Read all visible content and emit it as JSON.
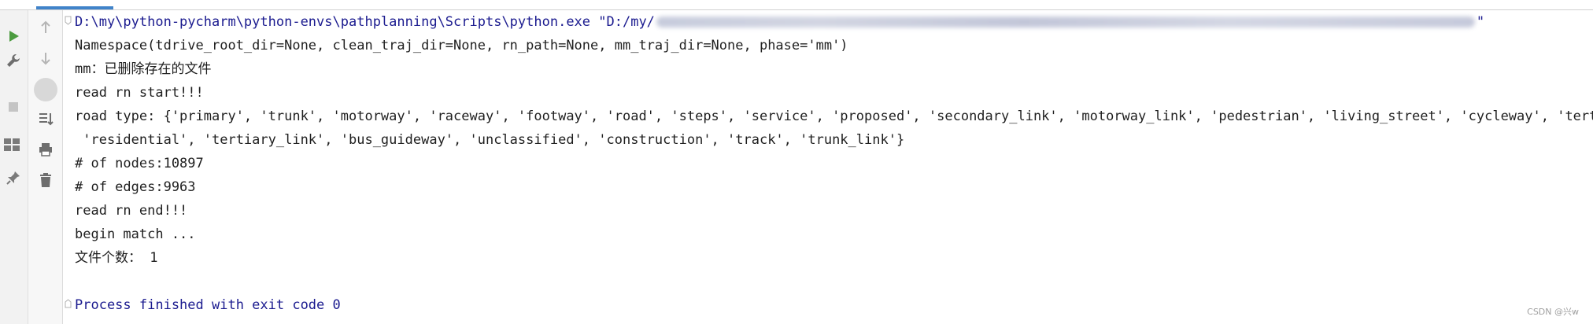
{
  "console": {
    "command": {
      "prefix": "D:\\my\\python-pycharm\\python-envs\\pathplanning\\Scripts\\python.exe \"D:/my/",
      "suffix": "\""
    },
    "output": [
      "Namespace(tdrive_root_dir=None, clean_traj_dir=None, rn_path=None, mm_traj_dir=None, phase='mm')",
      "mm：已删除存在的文件",
      "read rn start!!!",
      "road type: {'primary', 'trunk', 'motorway', 'raceway', 'footway', 'road', 'steps', 'service', 'proposed', 'secondary_link', 'motorway_link', 'pedestrian', 'living_street', 'cycleway', 'tertiary",
      " 'residential', 'tertiary_link', 'bus_guideway', 'unclassified', 'construction', 'track', 'trunk_link'}",
      "# of nodes:10897",
      "# of edges:9963",
      "read rn end!!!",
      "begin match ...",
      "文件个数： 1"
    ],
    "exit_message": "Process finished with exit code 0"
  },
  "watermark": "CSDN @兴w",
  "toolbar_icons": [
    "run-icon",
    "wrench-icon",
    "stop-icon",
    "layout-icon",
    "pin-icon",
    "arrow-up-icon",
    "arrow-down-icon",
    "circle-icon",
    "sort-down-icon",
    "print-icon",
    "trash-icon"
  ],
  "colors": {
    "command_text": "#1b1b8f",
    "output_text": "#1f1f1f",
    "run_green": "#4b9b3f",
    "tab_indicator": "#4083c9"
  }
}
